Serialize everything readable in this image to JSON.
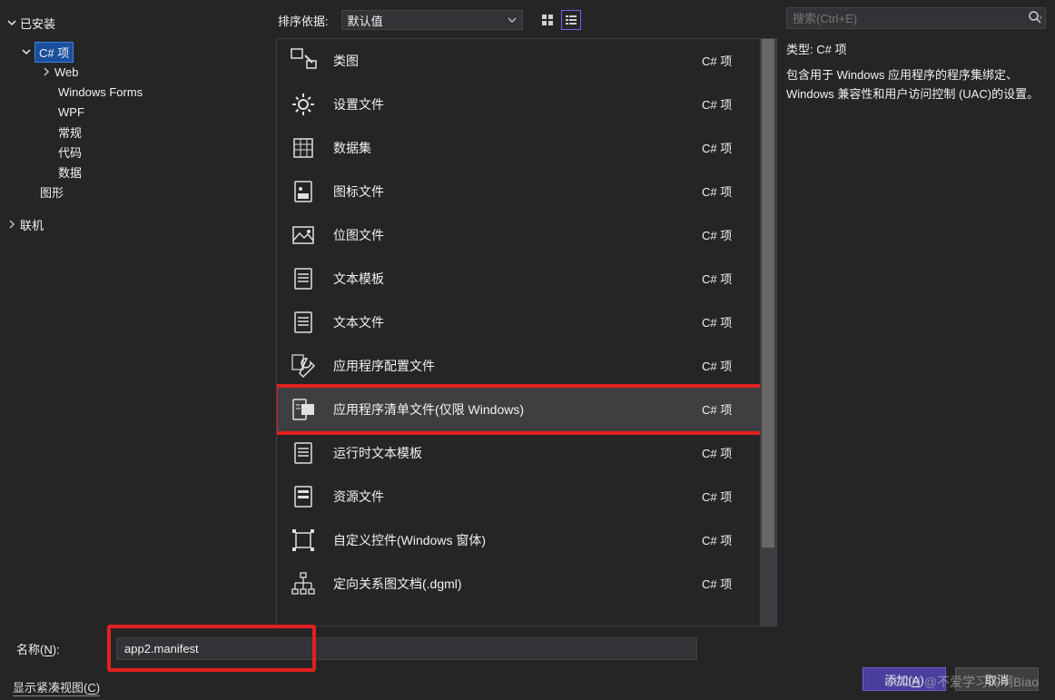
{
  "sidebar": {
    "installed_label": "已安装",
    "nodes": {
      "csproj": "C# 项",
      "web": "Web",
      "winforms": "Windows Forms",
      "wpf": "WPF",
      "general": "常规",
      "code": "代码",
      "data": "数据",
      "graphics": "图形",
      "online": "联机"
    }
  },
  "center": {
    "sort_label": "排序依据:",
    "sort_value": "默认值",
    "templates": [
      {
        "label": "类图",
        "lang": "C# 项",
        "icon": "class-diagram"
      },
      {
        "label": "设置文件",
        "lang": "C# 项",
        "icon": "gear"
      },
      {
        "label": "数据集",
        "lang": "C# 项",
        "icon": "dataset"
      },
      {
        "label": "图标文件",
        "lang": "C# 项",
        "icon": "icon-file"
      },
      {
        "label": "位图文件",
        "lang": "C# 项",
        "icon": "image"
      },
      {
        "label": "文本模板",
        "lang": "C# 项",
        "icon": "text"
      },
      {
        "label": "文本文件",
        "lang": "C# 项",
        "icon": "text"
      },
      {
        "label": "应用程序配置文件",
        "lang": "C# 项",
        "icon": "wrench"
      },
      {
        "label": "应用程序清单文件(仅限 Windows)",
        "lang": "C# 项",
        "icon": "manifest",
        "selected": true
      },
      {
        "label": "运行时文本模板",
        "lang": "C# 项",
        "icon": "text"
      },
      {
        "label": "资源文件",
        "lang": "C# 项",
        "icon": "resource"
      },
      {
        "label": "自定义控件(Windows 窗体)",
        "lang": "C# 项",
        "icon": "control"
      },
      {
        "label": "定向关系图文档(.dgml)",
        "lang": "C# 项",
        "icon": "graph"
      }
    ]
  },
  "right": {
    "search_placeholder": "搜索(Ctrl+E)",
    "type_label": "类型:",
    "type_value": "C# 项",
    "description": "包含用于 Windows 应用程序的程序集绑定、Windows 兼容性和用户访问控制 (UAC)的设置。"
  },
  "bottom": {
    "name_label": "名称(N):",
    "name_value": "app2.manifest",
    "compact_label": "显示紧凑视图(C)",
    "add_label": "添加(A)",
    "cancel_label": "取消"
  },
  "watermark": "CSDN @不爱学习的啊Biao"
}
